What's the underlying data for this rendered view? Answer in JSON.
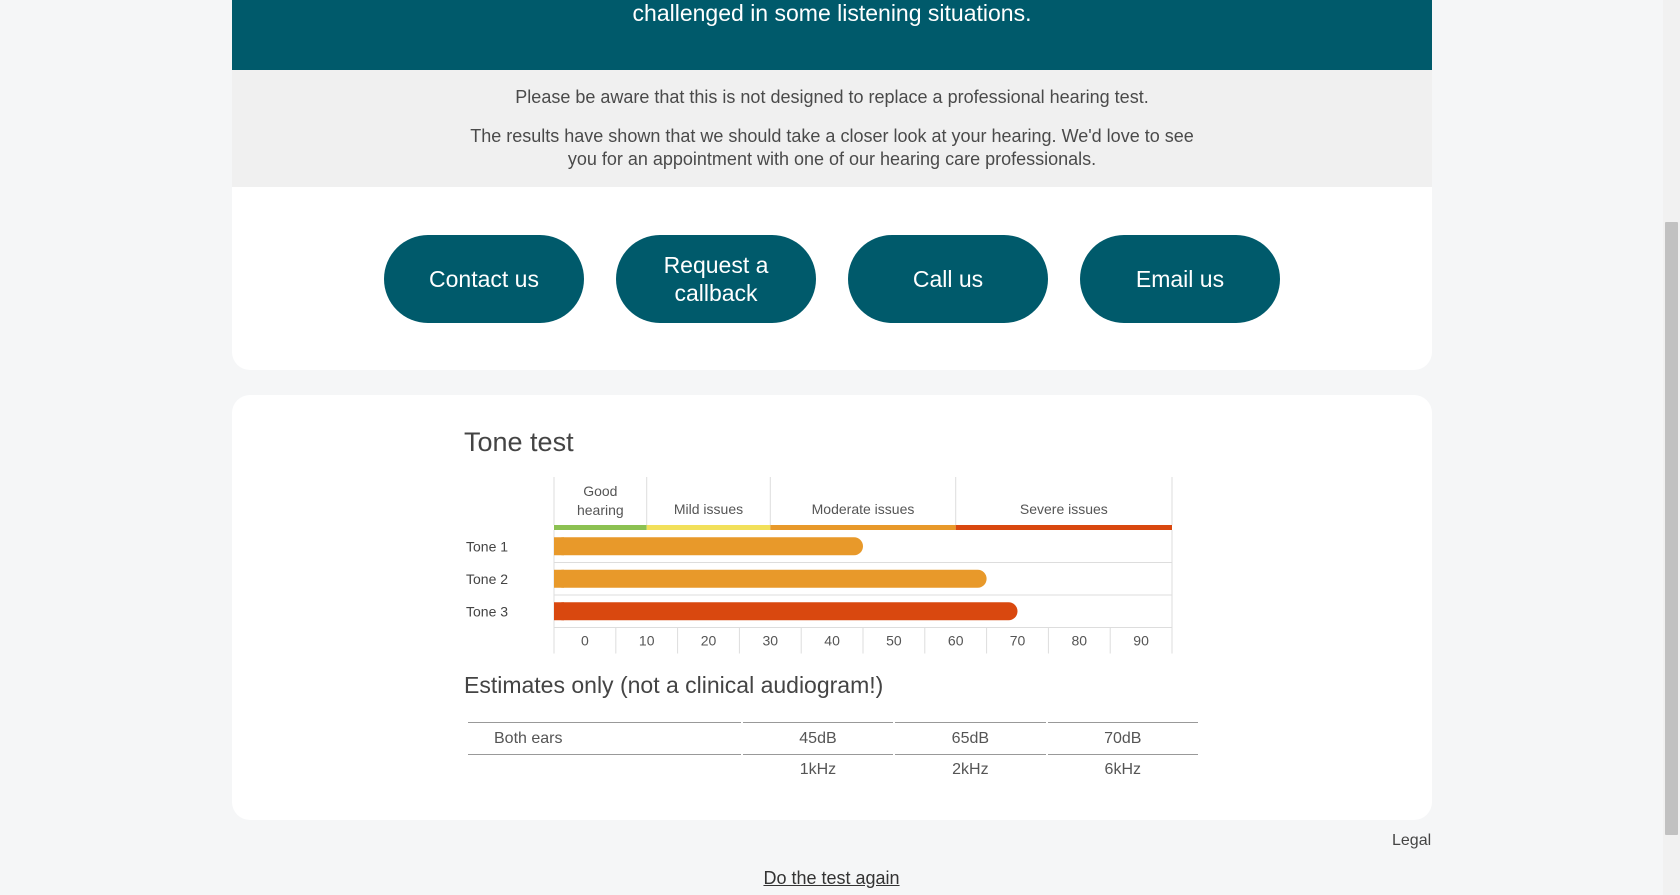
{
  "hero": {
    "text": "challenged in some listening situations."
  },
  "disclaimer": {
    "p1": "Please be aware that this is not designed to replace a professional hearing test.",
    "p2": "The results have shown that we should take a closer look at your hearing. We'd love to see you for an appointment with one of our hearing care professionals."
  },
  "cta": {
    "contact": "Contact us",
    "callback": "Request a callback",
    "call": "Call us",
    "email": "Email us"
  },
  "results": {
    "title": "Tone test",
    "estimates_title": "Estimates only (not a clinical audiogram!)"
  },
  "chart_data": {
    "type": "bar",
    "orientation": "horizontal",
    "categories": [
      "Tone 1",
      "Tone 2",
      "Tone 3"
    ],
    "values": [
      45,
      65,
      70
    ],
    "bar_colors": [
      "#e8992a",
      "#e8992a",
      "#d9480f"
    ],
    "xlim": [
      -5,
      95
    ],
    "x_ticks": [
      0,
      10,
      20,
      30,
      40,
      50,
      60,
      70,
      80,
      90
    ],
    "zones": [
      {
        "label": "Good hearing",
        "from": -5,
        "to": 10,
        "color": "#8cc152"
      },
      {
        "label": "Mild issues",
        "from": 10,
        "to": 30,
        "color": "#f2e05a"
      },
      {
        "label": "Moderate issues",
        "from": 30,
        "to": 60,
        "color": "#e8992a"
      },
      {
        "label": "Severe issues",
        "from": 60,
        "to": 95,
        "color": "#d9480f"
      }
    ]
  },
  "estimates": {
    "row_label": "Both ears",
    "values": [
      "45dB",
      "65dB",
      "70dB"
    ],
    "frequencies": [
      "1kHz",
      "2kHz",
      "6kHz"
    ]
  },
  "footer": {
    "legal": "Legal",
    "again": "Do the test again"
  }
}
